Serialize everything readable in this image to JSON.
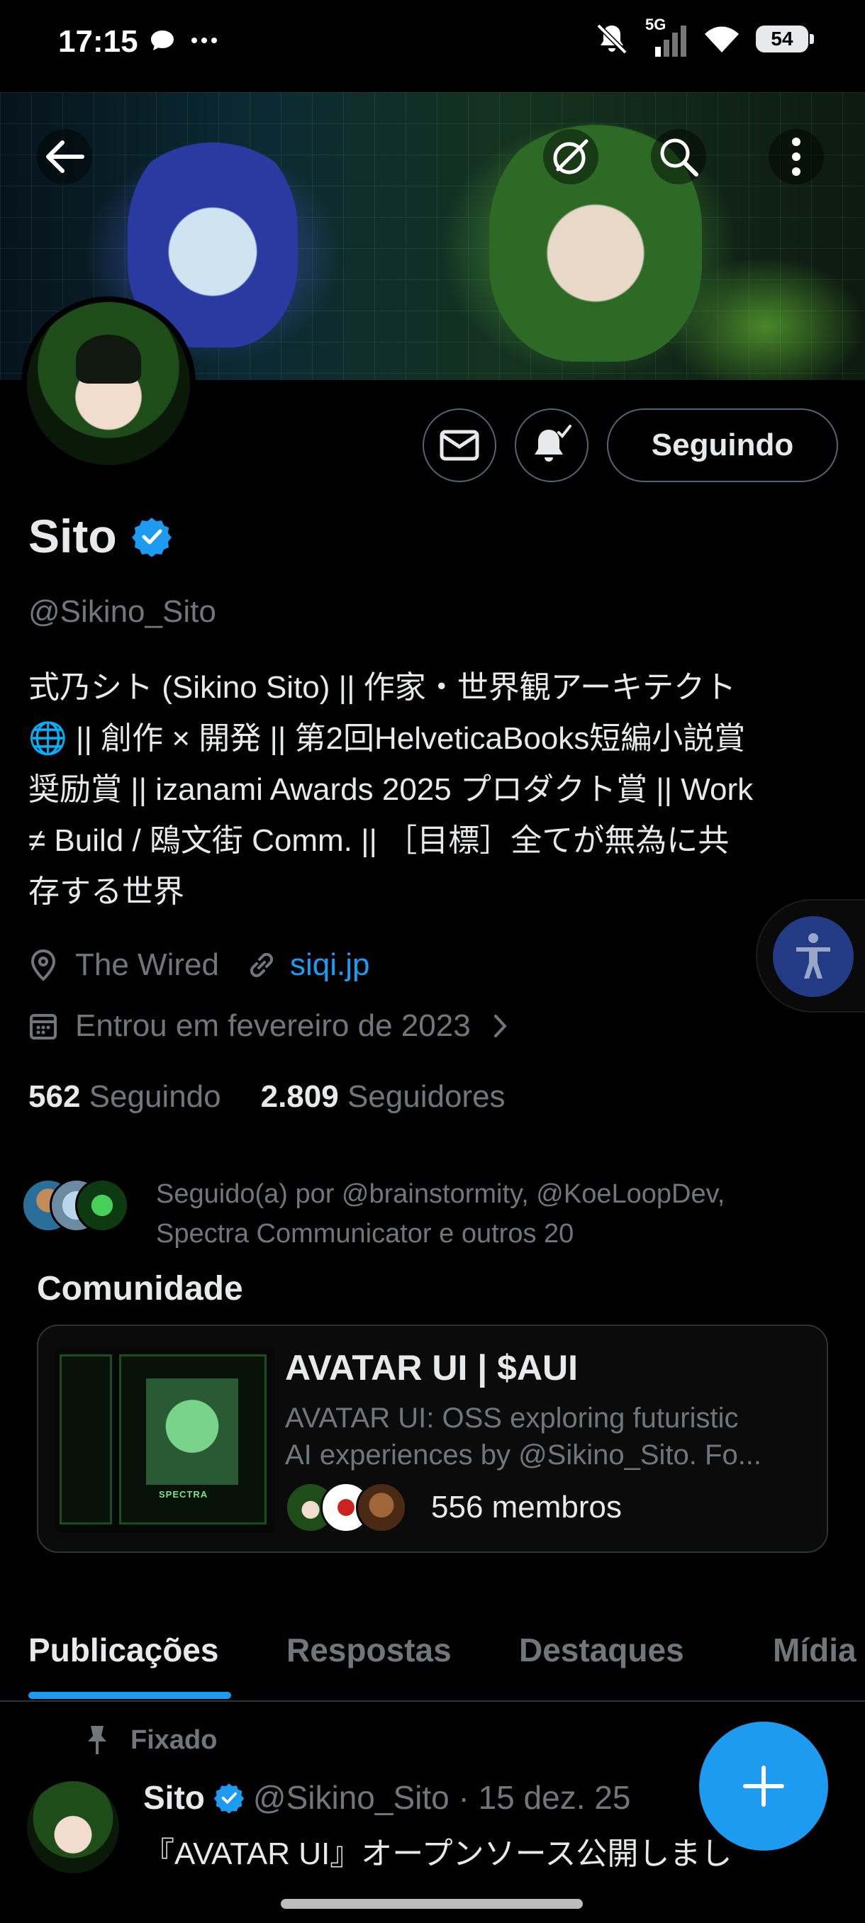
{
  "status_bar": {
    "time": "17:15",
    "network": "5G",
    "battery": "54",
    "icons": [
      "message-bubble-icon",
      "more-dots-icon",
      "mute-icon",
      "signal-icon",
      "wifi-icon",
      "battery-icon"
    ]
  },
  "header": {
    "back_icon": "arrow-left-icon",
    "actions": [
      "grok-icon",
      "search-icon",
      "more-vertical-icon"
    ]
  },
  "profile": {
    "name": "Sito",
    "handle": "@Sikino_Sito",
    "verified": true,
    "bio_lines": [
      "式乃シト (Sikino Sito) || 作家・世界観アーキテクト",
      "🌐 || 創作 × 開発 || 第2回HelveticaBooks短編小説賞",
      "奨励賞 || izanami Awards 2025 プロダクト賞 || Work",
      "≠ Build / 鴎文街 Comm. || ［目標］全てが無為に共",
      "存する世界"
    ],
    "location": "The Wired",
    "website": "siqi.jp",
    "joined": "Entrou em fevereiro de 2023",
    "following_count": "562",
    "following_label": "Seguindo",
    "followers_count": "2.809",
    "followers_label": "Seguidores",
    "followed_by_line1": "Seguido(a) por @brainstormity, @KoeLoopDev,",
    "followed_by_line2": "Spectra Communicator e outros 20"
  },
  "actions": {
    "follow_label": "Seguindo"
  },
  "community": {
    "section_title": "Comunidade",
    "thumb_tag": "SPECTRA",
    "title": "AVATAR UI | $AUI",
    "description_line1": "AVATAR UI: OSS exploring futuristic",
    "description_line2": "AI experiences by @Sikino_Sito. Fo...",
    "members": "556 membros"
  },
  "tabs": [
    {
      "label": "Publicações",
      "active": true
    },
    {
      "label": "Respostas",
      "active": false
    },
    {
      "label": "Destaques",
      "active": false
    },
    {
      "label": "Mídia",
      "active": false
    }
  ],
  "pinned_post": {
    "pinned_label": "Fixado",
    "author_name": "Sito",
    "author_handle": "@Sikino_Sito · 15 dez. 25",
    "text": "『AVATAR UI』オープンソース公開しまし"
  },
  "colors": {
    "accent": "#1d9bf0",
    "background": "#000000",
    "muted_text": "#71767b",
    "primary_text": "#e7e9ea"
  }
}
